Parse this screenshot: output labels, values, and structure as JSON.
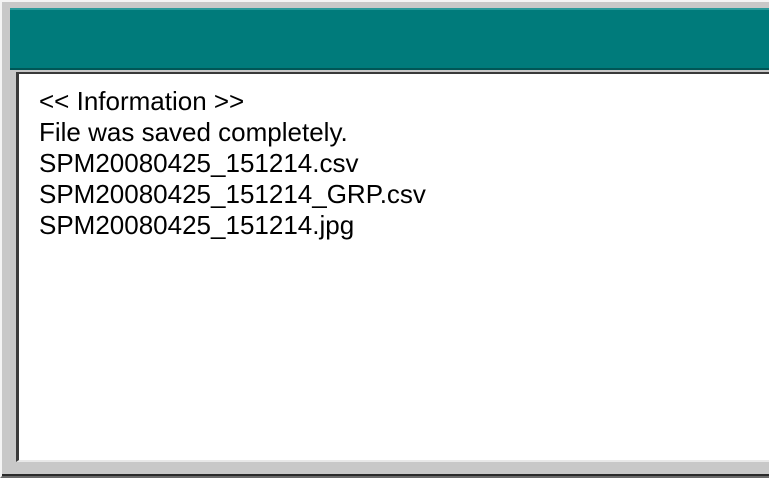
{
  "window": {
    "title": "",
    "accent_color": "#007b7b"
  },
  "message": {
    "lines": [
      "<< Information >>",
      "File was saved completely.",
      "SPM20080425_151214.csv",
      "SPM20080425_151214_GRP.csv",
      "SPM20080425_151214.jpg"
    ]
  }
}
